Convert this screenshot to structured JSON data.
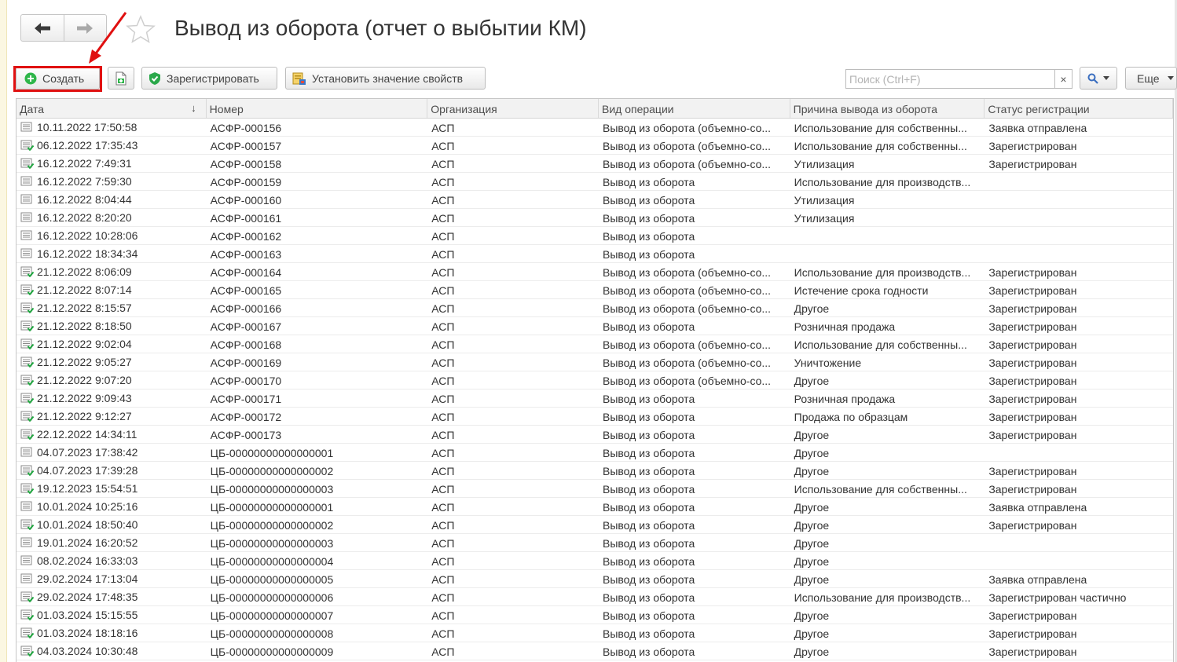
{
  "colors": {
    "highlight": "#e01010",
    "accent_green": "#2fb64a",
    "shield_green": "#2aa84a"
  },
  "nav": {
    "back_icon": "arrow-left-icon",
    "forward_icon": "arrow-right-icon",
    "favorite_icon": "star-icon"
  },
  "header": {
    "title": "Вывод из оборота (отчет о выбытии КМ)"
  },
  "toolbar": {
    "create_label": "Создать",
    "copy_icon": "copy-document-icon",
    "register_label": "Зарегистрировать",
    "set_props_label": "Установить значение свойств",
    "search_placeholder": "Поиск (Ctrl+F)",
    "search_clear": "×",
    "more_label": "Еще"
  },
  "table": {
    "columns": [
      "Дата",
      "Номер",
      "Организация",
      "Вид операции",
      "Причина вывода из оборота",
      "Статус регистрации"
    ],
    "sort_indicator": "↓",
    "rows": [
      {
        "date": "10.11.2022 17:50:58",
        "num": "АСФР-000156",
        "org": "АСП",
        "op": "Вывод из оборота (объемно-со...",
        "reason": "Использование для собственны...",
        "status": "Заявка отправлена",
        "posted": false
      },
      {
        "date": "06.12.2022 17:35:43",
        "num": "АСФР-000157",
        "org": "АСП",
        "op": "Вывод из оборота (объемно-со...",
        "reason": "Использование для собственны...",
        "status": "Зарегистрирован",
        "posted": true
      },
      {
        "date": "16.12.2022 7:49:31",
        "num": "АСФР-000158",
        "org": "АСП",
        "op": "Вывод из оборота (объемно-со...",
        "reason": "Утилизация",
        "status": "Зарегистрирован",
        "posted": true
      },
      {
        "date": "16.12.2022 7:59:30",
        "num": "АСФР-000159",
        "org": "АСП",
        "op": "Вывод из оборота",
        "reason": "Использование для производств...",
        "status": "",
        "posted": false
      },
      {
        "date": "16.12.2022 8:04:44",
        "num": "АСФР-000160",
        "org": "АСП",
        "op": "Вывод из оборота",
        "reason": "Утилизация",
        "status": "",
        "posted": false
      },
      {
        "date": "16.12.2022 8:20:20",
        "num": "АСФР-000161",
        "org": "АСП",
        "op": "Вывод из оборота",
        "reason": "Утилизация",
        "status": "",
        "posted": false
      },
      {
        "date": "16.12.2022 10:28:06",
        "num": "АСФР-000162",
        "org": "АСП",
        "op": "Вывод из оборота",
        "reason": "",
        "status": "",
        "posted": false
      },
      {
        "date": "16.12.2022 18:34:34",
        "num": "АСФР-000163",
        "org": "АСП",
        "op": "Вывод из оборота",
        "reason": "",
        "status": "",
        "posted": false
      },
      {
        "date": "21.12.2022 8:06:09",
        "num": "АСФР-000164",
        "org": "АСП",
        "op": "Вывод из оборота (объемно-со...",
        "reason": "Использование для производств...",
        "status": "Зарегистрирован",
        "posted": true
      },
      {
        "date": "21.12.2022 8:07:14",
        "num": "АСФР-000165",
        "org": "АСП",
        "op": "Вывод из оборота (объемно-со...",
        "reason": "Истечение срока годности",
        "status": "Зарегистрирован",
        "posted": true
      },
      {
        "date": "21.12.2022 8:15:57",
        "num": "АСФР-000166",
        "org": "АСП",
        "op": "Вывод из оборота (объемно-со...",
        "reason": "Другое",
        "status": "Зарегистрирован",
        "posted": true
      },
      {
        "date": "21.12.2022 8:18:50",
        "num": "АСФР-000167",
        "org": "АСП",
        "op": "Вывод из оборота",
        "reason": "Розничная продажа",
        "status": "Зарегистрирован",
        "posted": true
      },
      {
        "date": "21.12.2022 9:02:04",
        "num": "АСФР-000168",
        "org": "АСП",
        "op": "Вывод из оборота (объемно-со...",
        "reason": "Использование для собственны...",
        "status": "Зарегистрирован",
        "posted": true
      },
      {
        "date": "21.12.2022 9:05:27",
        "num": "АСФР-000169",
        "org": "АСП",
        "op": "Вывод из оборота (объемно-со...",
        "reason": "Уничтожение",
        "status": "Зарегистрирован",
        "posted": true
      },
      {
        "date": "21.12.2022 9:07:20",
        "num": "АСФР-000170",
        "org": "АСП",
        "op": "Вывод из оборота (объемно-со...",
        "reason": "Другое",
        "status": "Зарегистрирован",
        "posted": true
      },
      {
        "date": "21.12.2022 9:09:43",
        "num": "АСФР-000171",
        "org": "АСП",
        "op": "Вывод из оборота",
        "reason": "Розничная продажа",
        "status": "Зарегистрирован",
        "posted": true
      },
      {
        "date": "21.12.2022 9:12:27",
        "num": "АСФР-000172",
        "org": "АСП",
        "op": "Вывод из оборота",
        "reason": "Продажа по образцам",
        "status": "Зарегистрирован",
        "posted": true
      },
      {
        "date": "22.12.2022 14:34:11",
        "num": "АСФР-000173",
        "org": "АСП",
        "op": "Вывод из оборота",
        "reason": "Другое",
        "status": "Зарегистрирован",
        "posted": true
      },
      {
        "date": "04.07.2023 17:38:42",
        "num": "ЦБ-00000000000000001",
        "org": "АСП",
        "op": "Вывод из оборота",
        "reason": "Другое",
        "status": "",
        "posted": false
      },
      {
        "date": "04.07.2023 17:39:28",
        "num": "ЦБ-00000000000000002",
        "org": "АСП",
        "op": "Вывод из оборота",
        "reason": "Другое",
        "status": "Зарегистрирован",
        "posted": true
      },
      {
        "date": "19.12.2023 15:54:51",
        "num": "ЦБ-00000000000000003",
        "org": "АСП",
        "op": "Вывод из оборота",
        "reason": "Использование для собственны...",
        "status": "Зарегистрирован",
        "posted": true
      },
      {
        "date": "10.01.2024 10:25:16",
        "num": "ЦБ-00000000000000001",
        "org": "АСП",
        "op": "Вывод из оборота",
        "reason": "Другое",
        "status": "Заявка отправлена",
        "posted": false
      },
      {
        "date": "10.01.2024 18:50:40",
        "num": "ЦБ-00000000000000002",
        "org": "АСП",
        "op": "Вывод из оборота",
        "reason": "Другое",
        "status": "Зарегистрирован",
        "posted": true
      },
      {
        "date": "19.01.2024 16:20:52",
        "num": "ЦБ-00000000000000003",
        "org": "АСП",
        "op": "Вывод из оборота",
        "reason": "Другое",
        "status": "",
        "posted": false
      },
      {
        "date": "08.02.2024 16:33:03",
        "num": "ЦБ-00000000000000004",
        "org": "АСП",
        "op": "Вывод из оборота",
        "reason": "Другое",
        "status": "",
        "posted": false
      },
      {
        "date": "29.02.2024 17:13:04",
        "num": "ЦБ-00000000000000005",
        "org": "АСП",
        "op": "Вывод из оборота",
        "reason": "Другое",
        "status": "Заявка отправлена",
        "posted": false
      },
      {
        "date": "29.02.2024 17:48:35",
        "num": "ЦБ-00000000000000006",
        "org": "АСП",
        "op": "Вывод из оборота",
        "reason": "Использование для производств...",
        "status": "Зарегистрирован частично",
        "posted": true
      },
      {
        "date": "01.03.2024 15:15:55",
        "num": "ЦБ-00000000000000007",
        "org": "АСП",
        "op": "Вывод из оборота",
        "reason": "Другое",
        "status": "Зарегистрирован",
        "posted": true
      },
      {
        "date": "01.03.2024 18:18:16",
        "num": "ЦБ-00000000000000008",
        "org": "АСП",
        "op": "Вывод из оборота",
        "reason": "Другое",
        "status": "Зарегистрирован",
        "posted": true
      },
      {
        "date": "04.03.2024 10:30:48",
        "num": "ЦБ-00000000000000009",
        "org": "АСП",
        "op": "Вывод из оборота",
        "reason": "Другое",
        "status": "Зарегистрирован",
        "posted": true
      }
    ]
  }
}
